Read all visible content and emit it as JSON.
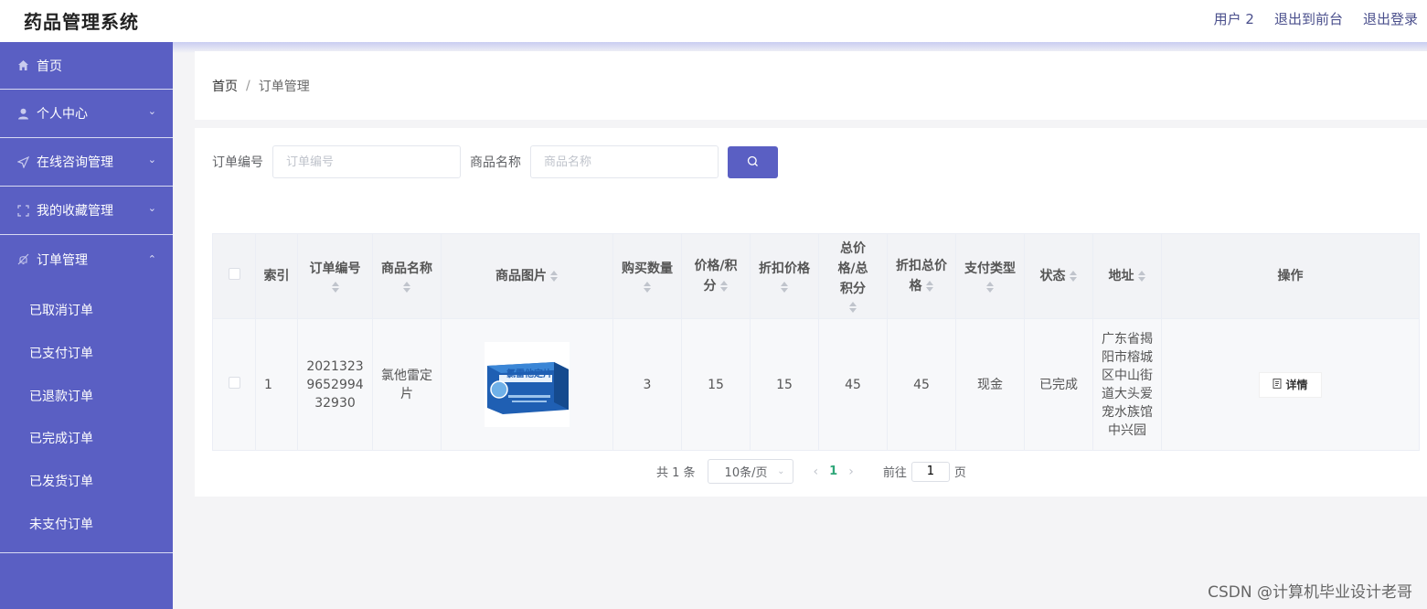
{
  "header": {
    "title": "药品管理系统",
    "user": "用户 2",
    "back_front": "退出到前台",
    "logout": "退出登录"
  },
  "sidebar": {
    "items": [
      {
        "label": "首页",
        "icon": "home-icon"
      },
      {
        "label": "个人中心",
        "icon": "user-icon"
      },
      {
        "label": "在线咨询管理",
        "icon": "send-icon"
      },
      {
        "label": "我的收藏管理",
        "icon": "fullscreen-icon"
      },
      {
        "label": "订单管理",
        "icon": "bell-off-icon"
      }
    ],
    "order_sub": [
      "已取消订单",
      "已支付订单",
      "已退款订单",
      "已完成订单",
      "已发货订单",
      "未支付订单"
    ]
  },
  "breadcrumb": {
    "home": "首页",
    "sep": "/",
    "current": "订单管理"
  },
  "search": {
    "order_label": "订单编号",
    "order_placeholder": "订单编号",
    "product_label": "商品名称",
    "product_placeholder": "商品名称"
  },
  "table": {
    "headers": {
      "index": "索引",
      "order_no": "订单编号",
      "name": "商品名称",
      "image": "商品图片",
      "qty": "购买数量",
      "price": "价格/积分",
      "discount": "折扣价格",
      "total": "总价格/总积分",
      "discount_total": "折扣总价格",
      "pay_type": "支付类型",
      "status": "状态",
      "address": "地址",
      "ops": "操作"
    },
    "rows": [
      {
        "index": "1",
        "order_no": "2021323965299432930",
        "name": "氯他雷定片",
        "image_text": "氯雷他定片",
        "qty": "3",
        "price": "15",
        "discount": "15",
        "total": "45",
        "discount_total": "45",
        "pay_type": "现金",
        "status": "已完成",
        "address": "广东省揭阳市榕城区中山街道大头爱宠水族馆中兴园",
        "detail": "详情"
      }
    ]
  },
  "pager": {
    "total": "共 1 条",
    "size": "10条/页",
    "page": "1",
    "goto": "前往",
    "goto_value": "1",
    "unit": "页"
  },
  "watermark": "CSDN @计算机毕业设计老哥",
  "colors": {
    "sidebar": "#5a5fc3",
    "accent": "#5a5fc3",
    "page_active": "#2fa779"
  }
}
